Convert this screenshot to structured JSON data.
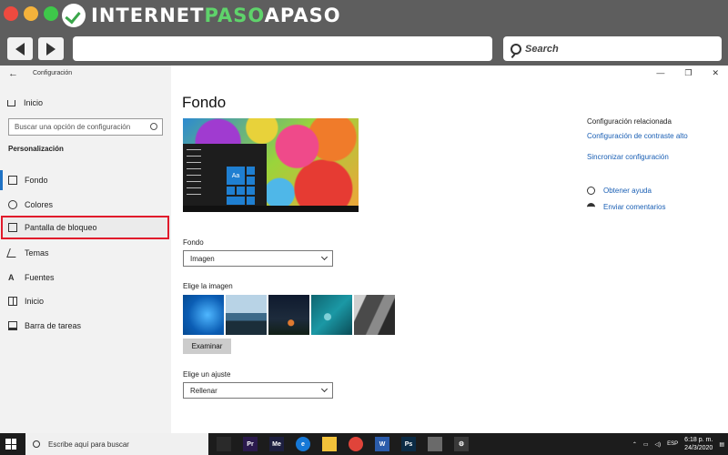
{
  "browser": {
    "logo": {
      "part1": "INTERNET",
      "part2": "PASO",
      "part3": "APASO"
    },
    "search_placeholder": "Search"
  },
  "sidebar": {
    "title": "Configuración",
    "home": "Inicio",
    "search_placeholder": "Buscar una opción de configuración",
    "section": "Personalización",
    "items": [
      {
        "label": "Fondo",
        "icon": "image-icon"
      },
      {
        "label": "Colores",
        "icon": "palette-icon"
      },
      {
        "label": "Pantalla de bloqueo",
        "icon": "lockscreen-icon"
      },
      {
        "label": "Temas",
        "icon": "brush-icon"
      },
      {
        "label": "Fuentes",
        "icon": "font-icon"
      },
      {
        "label": "Inicio",
        "icon": "start-icon"
      },
      {
        "label": "Barra de tareas",
        "icon": "taskbar-icon"
      }
    ]
  },
  "main": {
    "title": "Fondo",
    "preview_tile": "Aa",
    "fondo_label": "Fondo",
    "fondo_value": "Imagen",
    "choose_label": "Elige la imagen",
    "browse_button": "Examinar",
    "fit_label": "Elige un ajuste",
    "fit_value": "Rellenar"
  },
  "related": {
    "title": "Configuración relacionada",
    "links": [
      "Configuración de contraste alto",
      "Sincronizar configuración"
    ],
    "help": "Obtener ayuda",
    "feedback": "Enviar comentarios"
  },
  "taskbar": {
    "search_placeholder": "Escribe aquí para buscar",
    "apps": [
      {
        "name": "film-icon",
        "label": "",
        "color": "#2a2a2a"
      },
      {
        "name": "premiere-icon",
        "label": "Pr",
        "color": "#2b1a4d"
      },
      {
        "name": "media-encoder-icon",
        "label": "Me",
        "color": "#1d1f3f"
      },
      {
        "name": "edge-icon",
        "label": "e",
        "color": "#1678d6"
      },
      {
        "name": "folder-icon",
        "label": "",
        "color": "#f2c23a"
      },
      {
        "name": "chrome-icon",
        "label": "",
        "color": "#e0443a"
      },
      {
        "name": "word-icon",
        "label": "W",
        "color": "#2b5cab"
      },
      {
        "name": "photoshop-icon",
        "label": "Ps",
        "color": "#0b2b45"
      },
      {
        "name": "photos-icon",
        "label": "",
        "color": "#6a6a6a"
      },
      {
        "name": "settings-icon",
        "label": "⚙",
        "color": "#3a3a3a"
      }
    ],
    "language": "ESP",
    "time": "6:18 p. m.",
    "date": "24/3/2020"
  }
}
